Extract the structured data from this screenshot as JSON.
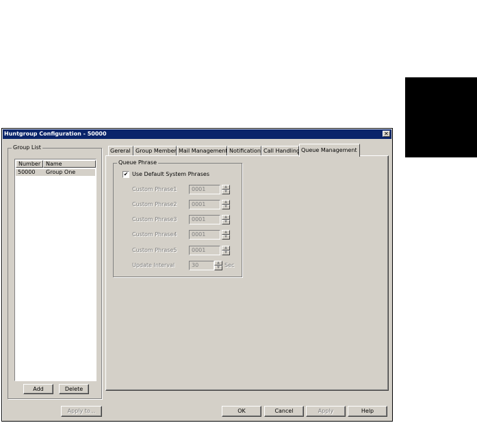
{
  "window": {
    "title": "Huntgroup Configuration - 50000",
    "close_label": "✕"
  },
  "group_list": {
    "legend": "Group List",
    "columns": [
      "Number",
      "Name"
    ],
    "rows": [
      {
        "number": "50000",
        "name": "Group One"
      }
    ],
    "add_label": "Add",
    "delete_label": "Delete"
  },
  "tabs": [
    {
      "label": "Gereral"
    },
    {
      "label": "Group Member"
    },
    {
      "label": "Mail Management"
    },
    {
      "label": "Notification"
    },
    {
      "label": "Call Handling"
    },
    {
      "label": "Queue Management",
      "active": true
    }
  ],
  "queue_phrase": {
    "legend": "Queue Phrase",
    "use_default_label": "Use Default System Phrases",
    "use_default_checked": true,
    "rows": [
      {
        "label": "Custom Phrase1",
        "value": "0001"
      },
      {
        "label": "Custom Phrase2",
        "value": "0001"
      },
      {
        "label": "Custom Phrase3",
        "value": "0001"
      },
      {
        "label": "Custom Phrase4",
        "value": "0001"
      },
      {
        "label": "Custom Phrase5",
        "value": "0001"
      }
    ],
    "update_interval": {
      "label": "Update Interval",
      "value": "30",
      "unit": "Sec"
    }
  },
  "buttons": {
    "apply_to": "Apply to...",
    "ok": "OK",
    "cancel": "Cancel",
    "apply": "Apply",
    "help": "Help"
  },
  "colors": {
    "titlebar": "#0a246a",
    "window_face": "#d4d0c8"
  }
}
